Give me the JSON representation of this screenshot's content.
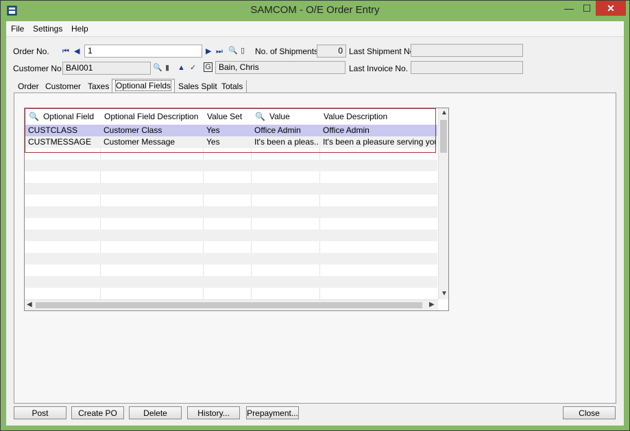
{
  "window": {
    "title": "SAMCOM - O/E Order Entry",
    "minimize": "—",
    "maximize": "☐",
    "close": "✕"
  },
  "menu": [
    "File",
    "Settings",
    "Help"
  ],
  "header": {
    "order_no_label": "Order No.",
    "order_no_value": "1",
    "shipments_label": "No. of Shipments",
    "shipments_value": "0",
    "last_shipment_label": "Last Shipment No.",
    "last_shipment_value": "",
    "customer_no_label": "Customer No.",
    "customer_no_value": "BAI001",
    "customer_name": "Bain, Chris",
    "last_invoice_label": "Last Invoice No.",
    "last_invoice_value": ""
  },
  "tabs": [
    "Order",
    "Customer",
    "Taxes",
    "Optional Fields",
    "Sales Split",
    "Totals"
  ],
  "active_tab": "Optional Fields",
  "grid": {
    "columns": [
      "Optional Field",
      "Optional Field Description",
      "Value Set",
      "Value",
      "Value Description"
    ],
    "rows": [
      [
        "CUSTCLASS",
        "Customer Class",
        "Yes",
        "Office Admin",
        "Office Admin"
      ],
      [
        "CUSTMESSAGE",
        "Customer Message",
        "Yes",
        "It's been a pleas...",
        "It's been a pleasure serving you!"
      ]
    ]
  },
  "buttons": {
    "post": "Post",
    "create_po": "Create PO",
    "delete": "Delete",
    "history": "History...",
    "prepayment": "Prepayment...",
    "close": "Close"
  },
  "colors": {
    "title_bar": "#86b866",
    "selected_row": "#c8c8f0",
    "highlight_border": "#b0303a"
  }
}
